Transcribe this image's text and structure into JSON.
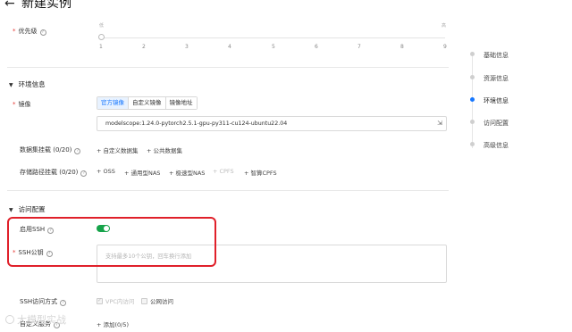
{
  "header": {
    "title": "新建实例"
  },
  "priority": {
    "label": "优先级",
    "low_label": "低",
    "high_label": "高",
    "ticks": [
      "1",
      "2",
      "3",
      "4",
      "5",
      "6",
      "7",
      "8",
      "9"
    ],
    "value": 1
  },
  "env_section": {
    "title": "环境信息",
    "image": {
      "label": "镜像",
      "tabs": [
        "官方镜像",
        "自定义镜像",
        "镜像地址"
      ],
      "active_tab": 0,
      "value": "modelscope:1.24.0-pytorch2.5.1-gpu-py311-cu124-ubuntu22.04"
    },
    "dataset": {
      "label": "数据集挂载 (0/20)",
      "actions": [
        "自定义数据集",
        "公共数据集"
      ]
    },
    "storage": {
      "label": "存储路径挂载 (0/20)",
      "actions": [
        "OSS",
        "通用型NAS",
        "极速型NAS",
        "CPFS",
        "智算CPFS"
      ]
    }
  },
  "access_section": {
    "title": "访问配置",
    "ssh_enable": {
      "label": "启用SSH",
      "on": true
    },
    "ssh_key": {
      "label": "SSH公钥",
      "placeholder": "支持最多10个公钥，回车换行添加"
    },
    "ssh_mode": {
      "label": "SSH访问方式",
      "options": [
        "VPC内访问",
        "公网访问"
      ]
    },
    "custom_service": {
      "label": "自定义服务",
      "add": "添加(0/5)"
    }
  },
  "side_nav": {
    "items": [
      "基础信息",
      "资源信息",
      "环境信息",
      "访问配置",
      "高级信息"
    ],
    "active": 2
  },
  "watermark": "大模型实战",
  "colors": {
    "accent": "#1677ff",
    "toggle_on": "#16a34a",
    "highlight": "#e0202a"
  }
}
